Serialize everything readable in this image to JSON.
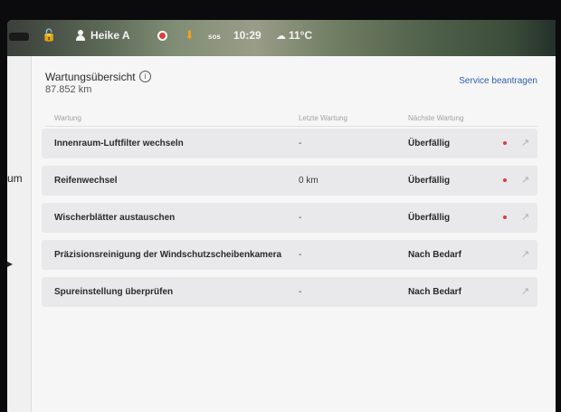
{
  "statusbar": {
    "user": "Heike A",
    "sos": "sos",
    "time": "10:29",
    "temperature": "11°C"
  },
  "sidebar": {
    "partial_label": "um",
    "partial_arrow": "▸"
  },
  "panel": {
    "title": "Wartungsübersicht",
    "odometer": "87.852 km",
    "service_button": "Service beantragen",
    "columns": {
      "task": "Wartung",
      "last": "Letzte Wartung",
      "next": "Nächste Wartung"
    },
    "rows": [
      {
        "name": "Innenraum-Luftfilter wechseln",
        "last": "-",
        "next": "Überfällig",
        "alert": true
      },
      {
        "name": "Reifenwechsel",
        "last": "0 km",
        "next": "Überfällig",
        "alert": true
      },
      {
        "name": "Wischerblätter austauschen",
        "last": "-",
        "next": "Überfällig",
        "alert": true
      },
      {
        "name": "Präzisionsreinigung der Windschutzscheibenkamera",
        "last": "-",
        "next": "Nach Bedarf",
        "alert": false
      },
      {
        "name": "Spureinstellung überprüfen",
        "last": "-",
        "next": "Nach Bedarf",
        "alert": false
      }
    ]
  },
  "colors": {
    "accent_link": "#2f5fb4",
    "alert_dot": "#e23a3a"
  },
  "icons": [
    "lock-icon",
    "user-icon",
    "recording-icon",
    "download-icon",
    "sos-icon",
    "cloud-icon",
    "info-icon",
    "open-arrow-icon"
  ]
}
